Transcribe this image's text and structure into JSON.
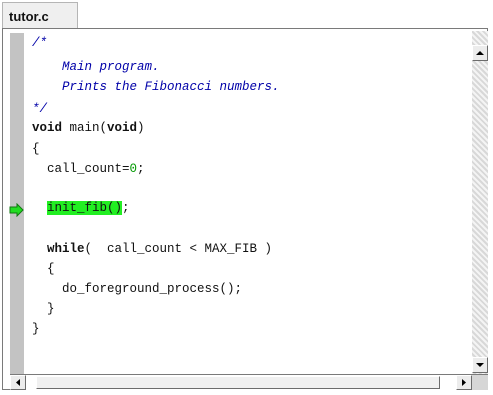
{
  "tab": {
    "label": "tutor.c"
  },
  "code": {
    "c1": "/*",
    "c2": "    Main program.",
    "c3": "    Prints the Fibonacci numbers.",
    "c4": "*/",
    "kw_void": "void",
    "main_mid": " main(",
    "kw_void2": "void",
    "main_end": ")",
    "brace_open": "{",
    "cc_text": "  call_count=",
    "cc_num": "0",
    "cc_end": ";",
    "init_fn": "init_fib()",
    "init_end": ";",
    "kw_while": "while",
    "while_rest": "(  call_count < MAX_FIB )",
    "inner_open": "  {",
    "dfp": "    do_foreground_process();",
    "inner_close": "  }",
    "brace_close": "}"
  },
  "icons": {
    "current_line": "green-arrow-icon",
    "scroll_up": "up-arrow-icon",
    "scroll_down": "down-arrow-icon",
    "scroll_left": "left-arrow-icon",
    "scroll_right": "right-arrow-icon"
  },
  "colors": {
    "highlight": "#22ee22",
    "comment": "#0000a8",
    "number": "#009900",
    "arrow": "#22dd22"
  }
}
